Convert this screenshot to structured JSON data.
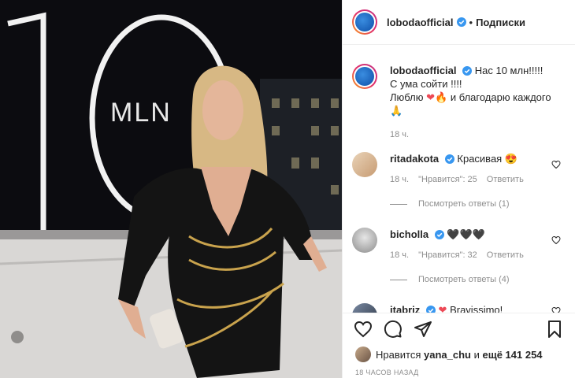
{
  "photo": {
    "overlay_text": "MLN"
  },
  "header": {
    "username": "lobodaofficial",
    "separator": "•",
    "follow_label": "Подписки"
  },
  "caption": {
    "username": "lobodaofficial",
    "line1": "Нас 10 млн!!!!!",
    "line2": "С ума сойти !!!!",
    "line3_a": "Люблю",
    "line3_b": "и благодарю каждого",
    "time": "18 ч."
  },
  "comments": [
    {
      "username": "ritadakota",
      "text": "Красивая",
      "time": "18 ч.",
      "likes": "\"Нравится\": 25",
      "reply": "Ответить",
      "view_replies": "Посмотреть ответы (1)"
    },
    {
      "username": "bicholla",
      "text": "",
      "time": "18 ч.",
      "likes": "\"Нравится\": 32",
      "reply": "Ответить",
      "view_replies": "Посмотреть ответы (4)"
    },
    {
      "username": "itabriz",
      "text": "Bravissimo!"
    }
  ],
  "likes": {
    "prefix": "Нравится",
    "user": "yana_chu",
    "middle": "и",
    "count": "ещё 141 254"
  },
  "timestamp": "18 ЧАСОВ НАЗАД",
  "colors": {
    "verified": "#3897f0",
    "heart": "#ed4956",
    "text": "#262626",
    "muted": "#8e8e8e"
  }
}
